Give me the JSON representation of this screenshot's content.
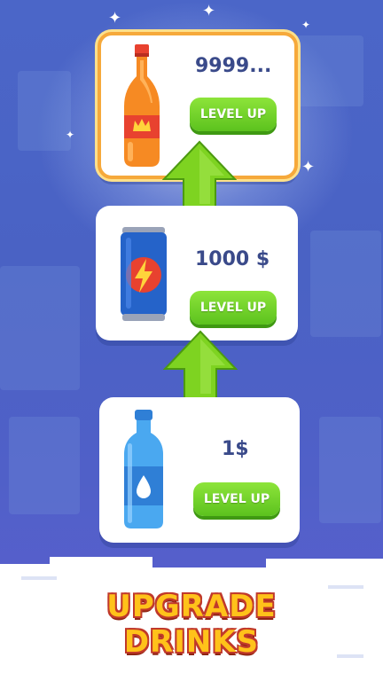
{
  "colors": {
    "accent_gold": "#f6a93b",
    "button_green": "#5cc21e",
    "price_text": "#3a4a8a",
    "banner_text": "#ffc21a",
    "banner_outline": "#c0392b"
  },
  "drinks": [
    {
      "name": "soda-bottle",
      "icon": "cola-bottle-icon",
      "price": "9999...",
      "button_label": "LEVEL UP",
      "highlighted": true
    },
    {
      "name": "energy-can",
      "icon": "energy-can-icon",
      "price": "1000 $",
      "button_label": "LEVEL UP",
      "highlighted": false
    },
    {
      "name": "water-bottle",
      "icon": "water-bottle-icon",
      "price": "1$",
      "button_label": "LEVEL UP",
      "highlighted": false
    }
  ],
  "banner": {
    "line1": "UPGRADE",
    "line2": "DRINKS"
  }
}
